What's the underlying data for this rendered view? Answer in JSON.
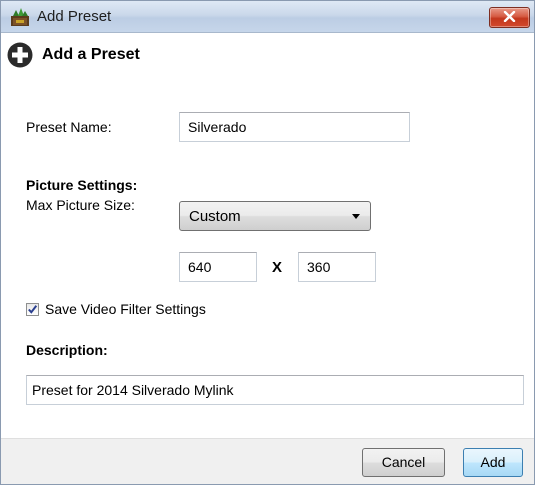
{
  "window": {
    "title": "Add Preset",
    "close_icon": "close-x-icon",
    "app_icon": "handbrake-icon"
  },
  "header": {
    "title": "Add a Preset",
    "icon": "plus-circle-icon"
  },
  "form": {
    "preset_name_label": "Preset Name:",
    "preset_name_value": "Silverado",
    "picture_settings_heading": "Picture Settings:",
    "max_picture_size_label": "Max Picture Size:",
    "max_picture_size_selected": "Custom",
    "width_value": "640",
    "dimension_separator": "X",
    "height_value": "360",
    "save_filter_checkbox_label": "Save Video Filter Settings",
    "save_filter_checked": true,
    "description_label": "Description:",
    "description_value": "Preset for 2014 Silverado Mylink"
  },
  "footer": {
    "cancel_label": "Cancel",
    "add_label": "Add"
  },
  "colors": {
    "close_button": "#c7432a",
    "default_button_border": "#3c7fb1",
    "footer_background": "#f0f0f0"
  }
}
